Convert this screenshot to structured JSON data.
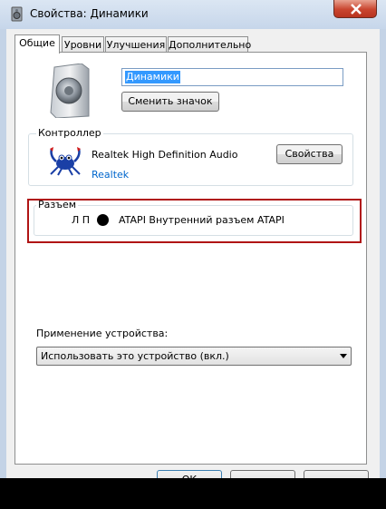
{
  "window": {
    "title": "Свойства: Динамики"
  },
  "tabs": [
    {
      "label": "Общие",
      "active": true
    },
    {
      "label": "Уровни",
      "active": false
    },
    {
      "label": "Улучшения",
      "active": false
    },
    {
      "label": "Дополнительно",
      "active": false
    }
  ],
  "device": {
    "icon": "speaker-icon",
    "name_value": "Динамики",
    "change_icon_label": "Сменить значок"
  },
  "controller": {
    "group_label": "Контроллер",
    "name": "Realtek High Definition Audio",
    "vendor_link": "Realtek",
    "properties_label": "Свойства",
    "icon": "realtek-crab-icon"
  },
  "jack": {
    "group_label": "Разъем",
    "channels": "Л П",
    "color": "#000000",
    "description": "ATAPI Внутренний разъем ATAPI",
    "highlight_color": "#b01515"
  },
  "usage": {
    "label": "Применение устройства:",
    "selected": "Использовать это устройство (вкл.)"
  },
  "footer": {
    "ok_label": "ОК"
  }
}
